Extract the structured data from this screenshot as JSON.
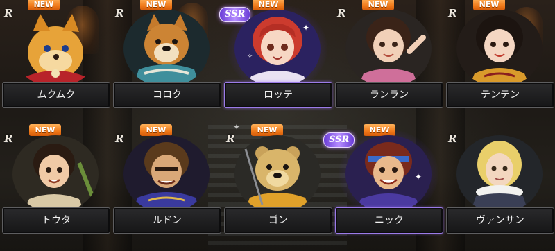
{
  "rarity_labels": {
    "r": "R",
    "ssr": "SSR"
  },
  "new_label": "NEW",
  "colors": {
    "new_badge": "#f07a1a",
    "ssr_accent": "#9b7be8",
    "name_plate": "#1f1f20",
    "name_text": "#f2f2f2"
  },
  "characters": [
    {
      "name": "ムクムク",
      "rarity": "R",
      "is_new": true
    },
    {
      "name": "コロク",
      "rarity": "R",
      "is_new": true
    },
    {
      "name": "ロッテ",
      "rarity": "SSR",
      "is_new": true
    },
    {
      "name": "ランラン",
      "rarity": "R",
      "is_new": true
    },
    {
      "name": "テンテン",
      "rarity": "R",
      "is_new": true
    },
    {
      "name": "トウタ",
      "rarity": "R",
      "is_new": true
    },
    {
      "name": "ルドン",
      "rarity": "R",
      "is_new": true
    },
    {
      "name": "ゴン",
      "rarity": "R",
      "is_new": true
    },
    {
      "name": "ニック",
      "rarity": "SSR",
      "is_new": true
    },
    {
      "name": "ヴァンサン",
      "rarity": "R",
      "is_new": false
    }
  ]
}
